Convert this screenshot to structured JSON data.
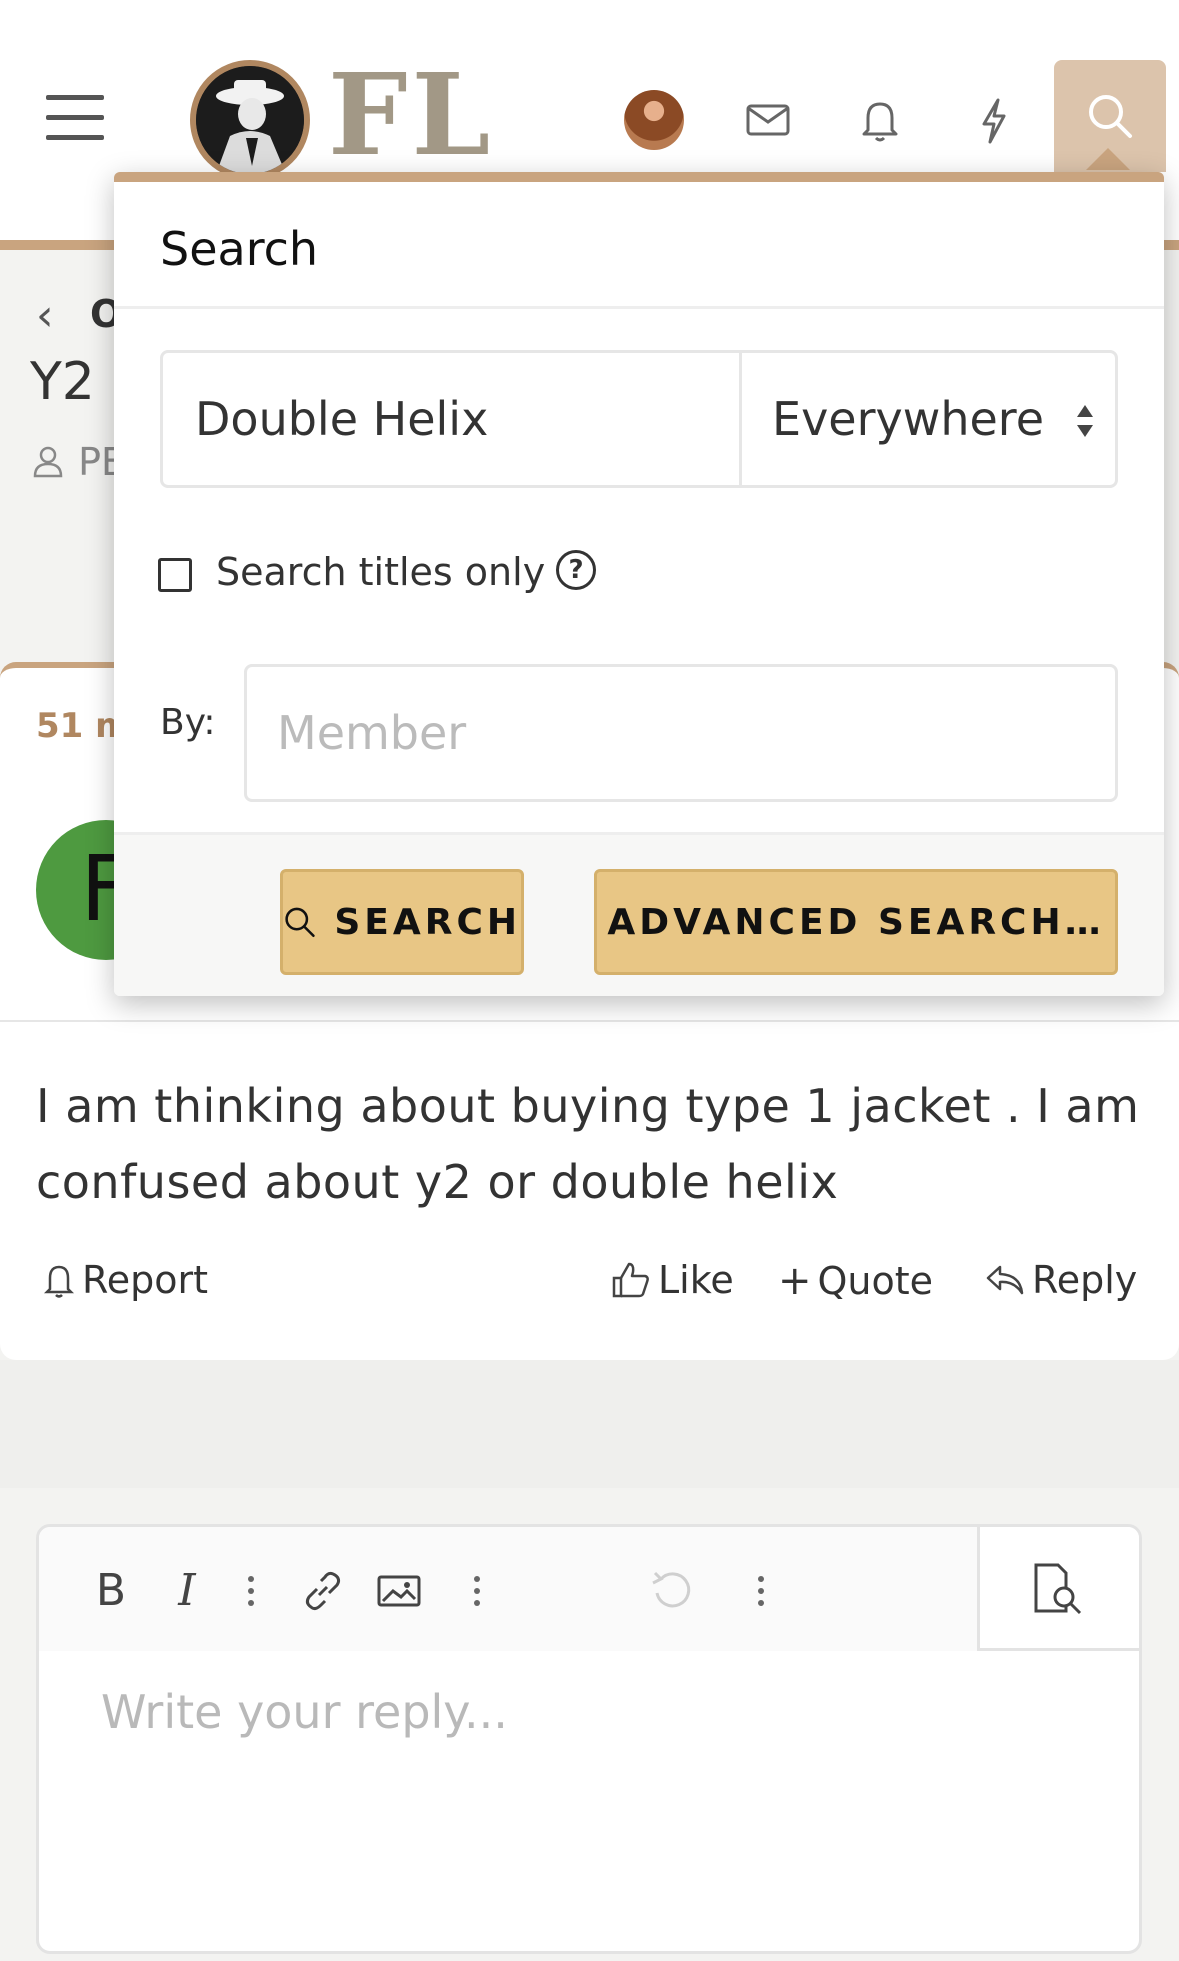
{
  "header": {
    "logo_text": "FL",
    "icons": [
      "menu-icon",
      "avatar",
      "mail-icon",
      "bell-icon",
      "lightning-icon",
      "search-icon"
    ]
  },
  "background_page": {
    "breadcrumb_text": "O",
    "title_fragment": "Y2 I",
    "author_fragment": "PE",
    "post_time_fragment": "51 m",
    "post_avatar_letter": "F",
    "post_body": "I am thinking about buying type 1 jacket . I am confused about y2 or double helix",
    "actions": {
      "report": "Report",
      "like": "Like",
      "quote": "Quote",
      "reply": "Reply"
    }
  },
  "editor": {
    "placeholder": "Write your reply..."
  },
  "search_popup": {
    "title": "Search",
    "query_value": "Double Helix",
    "scope_selected": "Everywhere",
    "titles_only_label": "Search titles only",
    "by_label": "By:",
    "member_placeholder": "Member",
    "search_button": "SEARCH",
    "advanced_button": "ADVANCED SEARCH…"
  },
  "colors": {
    "accent_brown": "#c9a47f",
    "button_gold": "#e8c685",
    "avatar_green": "#4e9a40"
  }
}
